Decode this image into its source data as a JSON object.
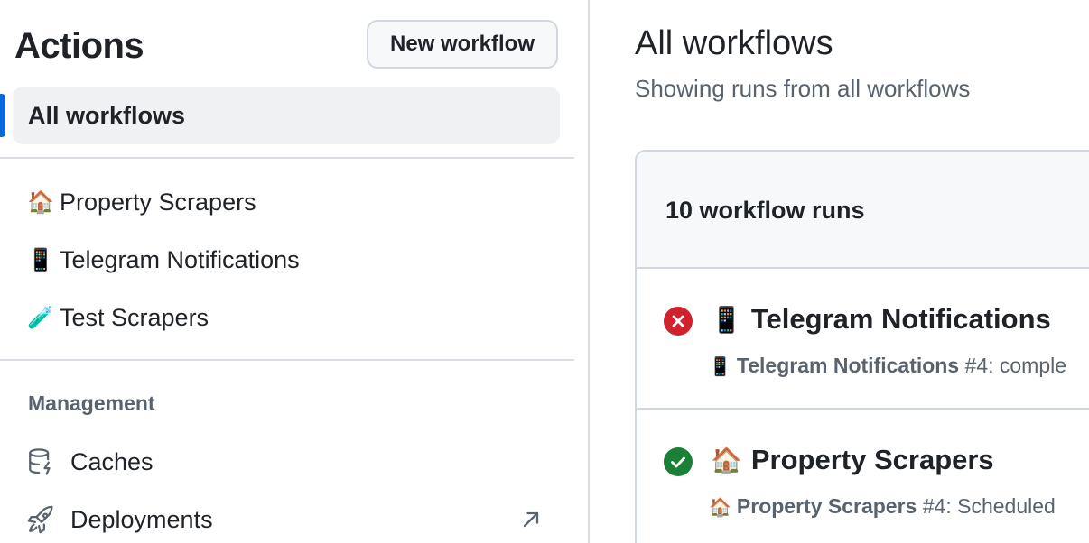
{
  "sidebar": {
    "title": "Actions",
    "new_workflow_label": "New workflow",
    "all_workflows_label": "All workflows",
    "workflows": [
      {
        "emoji": "🏠",
        "label": "Property Scrapers"
      },
      {
        "emoji": "📱",
        "label": "Telegram Notifications"
      },
      {
        "emoji": "🧪",
        "label": "Test Scrapers"
      }
    ],
    "management_heading": "Management",
    "management_items": [
      {
        "icon": "database-lightning-icon",
        "label": "Caches"
      },
      {
        "icon": "rocket-icon",
        "label": "Deployments",
        "external_icon": "arrow-up-right-icon"
      }
    ]
  },
  "main": {
    "title": "All workflows",
    "subtitle": "Showing runs from all workflows",
    "runs_count": "10 workflow runs",
    "runs": [
      {
        "status": "failure",
        "status_icon": "x-circle-icon",
        "emoji": "📱",
        "title": "Telegram Notifications",
        "meta_emoji": "📱",
        "meta_workflow": "Telegram Notifications",
        "meta_rest": " #4: comple"
      },
      {
        "status": "success",
        "status_icon": "check-circle-icon",
        "emoji": "🏠",
        "title": "Property Scrapers",
        "meta_emoji": "🏠",
        "meta_workflow": "Property Scrapers",
        "meta_rest": " #4: Scheduled"
      }
    ]
  },
  "colors": {
    "accent": "#0969da",
    "failure": "#cf222e",
    "success": "#1a7f37",
    "muted_text": "#59636e",
    "border": "#d0d7de"
  }
}
